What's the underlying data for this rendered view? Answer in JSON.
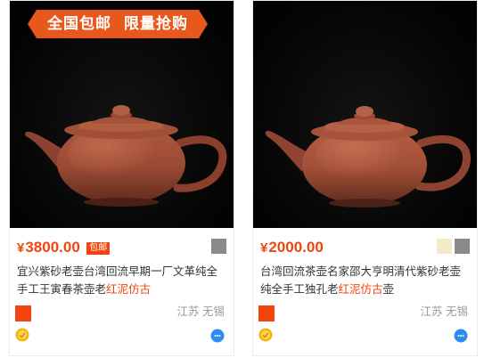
{
  "colors": {
    "accent": "#f2450e",
    "promo_bg": "#e8571c",
    "teapot_clay": "#9a4a34",
    "background": "#ffffff"
  },
  "banner": {
    "left_text": "全国包邮",
    "right_text": "限量抢购"
  },
  "products": [
    {
      "currency": "¥",
      "price": "3800.00",
      "shipping_badge": "包邮",
      "swatches": [
        "#8a8a8a"
      ],
      "title_plain": "宜兴紫砂老壶台湾回流早期一厂文革纯全手工王寅春茶壶老",
      "title_highlight": "红泥仿古",
      "title_tail": "",
      "location": "江苏 无锡",
      "seller_icon": "gold-medal-icon",
      "chat_icon": "chat-bubble-icon"
    },
    {
      "currency": "¥",
      "price": "2000.00",
      "shipping_badge": "",
      "swatches": [
        "#f3ebc8",
        "#8a8a8a"
      ],
      "title_plain": "台湾回流茶壶名家邵大亨明清代紫砂老壶纯全手工独孔老",
      "title_highlight": "红泥仿古",
      "title_tail": "壶",
      "location": "江苏 无锡",
      "seller_icon": "gold-medal-icon",
      "chat_icon": "chat-bubble-icon"
    }
  ]
}
